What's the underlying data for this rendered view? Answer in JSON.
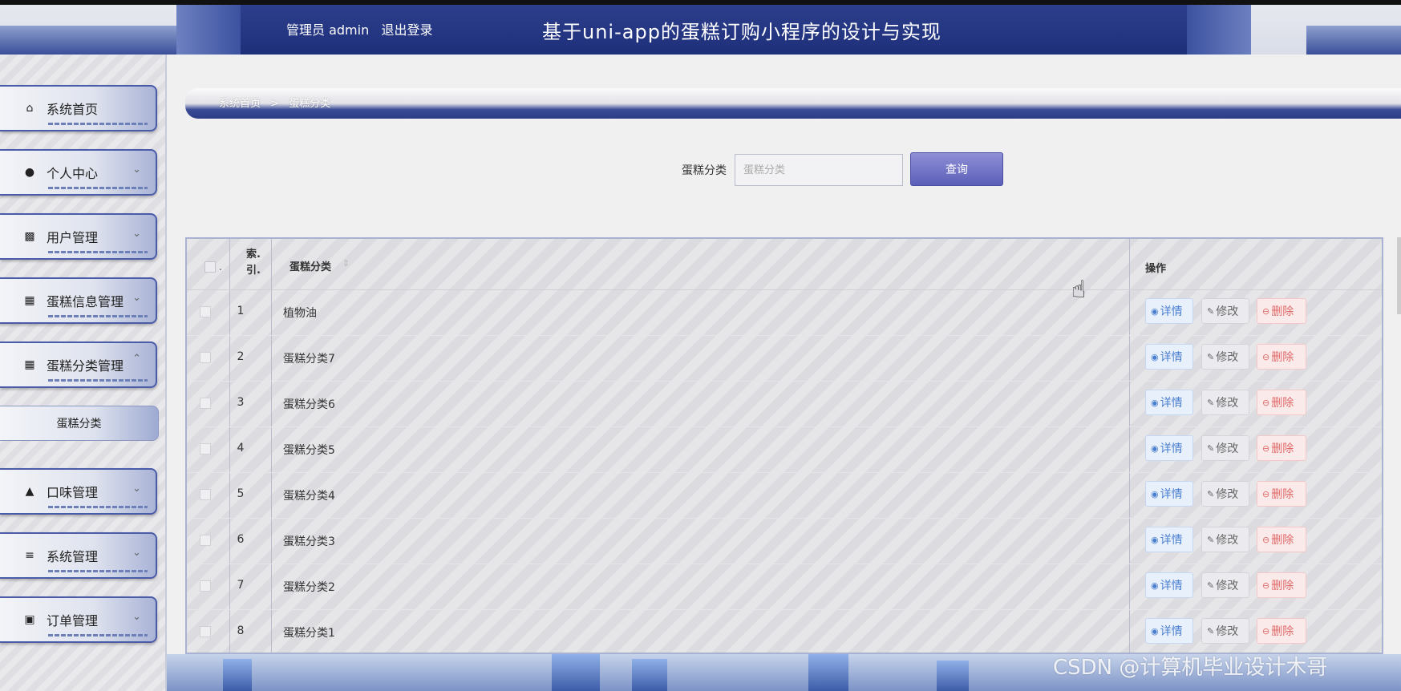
{
  "header": {
    "admin_label": "管理员 admin",
    "logout": "退出登录",
    "title": "基于uni-app的蛋糕订购小程序的设计与实现"
  },
  "sidebar": {
    "items": [
      {
        "label": "系统首页",
        "icon": "home-icon"
      },
      {
        "label": "个人中心",
        "icon": "user-icon"
      },
      {
        "label": "用户管理",
        "icon": "chat-icon"
      },
      {
        "label": "蛋糕信息管理",
        "icon": "grid-icon"
      },
      {
        "label": "蛋糕分类管理",
        "icon": "grid-icon"
      },
      {
        "label": "口味管理",
        "icon": "stamp-icon"
      },
      {
        "label": "系统管理",
        "icon": "sliders-icon"
      },
      {
        "label": "订单管理",
        "icon": "clipboard-icon"
      }
    ],
    "subitem": "蛋糕分类"
  },
  "breadcrumb": {
    "home": "系统首页",
    "separator": ">",
    "current": "蛋糕分类"
  },
  "search": {
    "label": "蛋糕分类",
    "placeholder": "蛋糕分类",
    "button": "查询"
  },
  "table": {
    "headers": {
      "index_line1": "索.",
      "index_line2": "引.",
      "category": "蛋糕分类",
      "ops": "操作"
    },
    "rows": [
      {
        "index": "1",
        "name": "植物油"
      },
      {
        "index": "2",
        "name": "蛋糕分类7"
      },
      {
        "index": "3",
        "name": "蛋糕分类6"
      },
      {
        "index": "4",
        "name": "蛋糕分类5"
      },
      {
        "index": "5",
        "name": "蛋糕分类4"
      },
      {
        "index": "6",
        "name": "蛋糕分类3"
      },
      {
        "index": "7",
        "name": "蛋糕分类2"
      },
      {
        "index": "8",
        "name": "蛋糕分类1"
      }
    ],
    "actions": {
      "detail": "详情",
      "edit": "修改",
      "delete": "删除"
    }
  },
  "watermark": "CSDN @计算机毕业设计木哥",
  "colors": {
    "header_blue": "#1e2f7a",
    "accent": "#5b5fb8",
    "detail": "#4a7fd0",
    "delete": "#e06a6a"
  }
}
